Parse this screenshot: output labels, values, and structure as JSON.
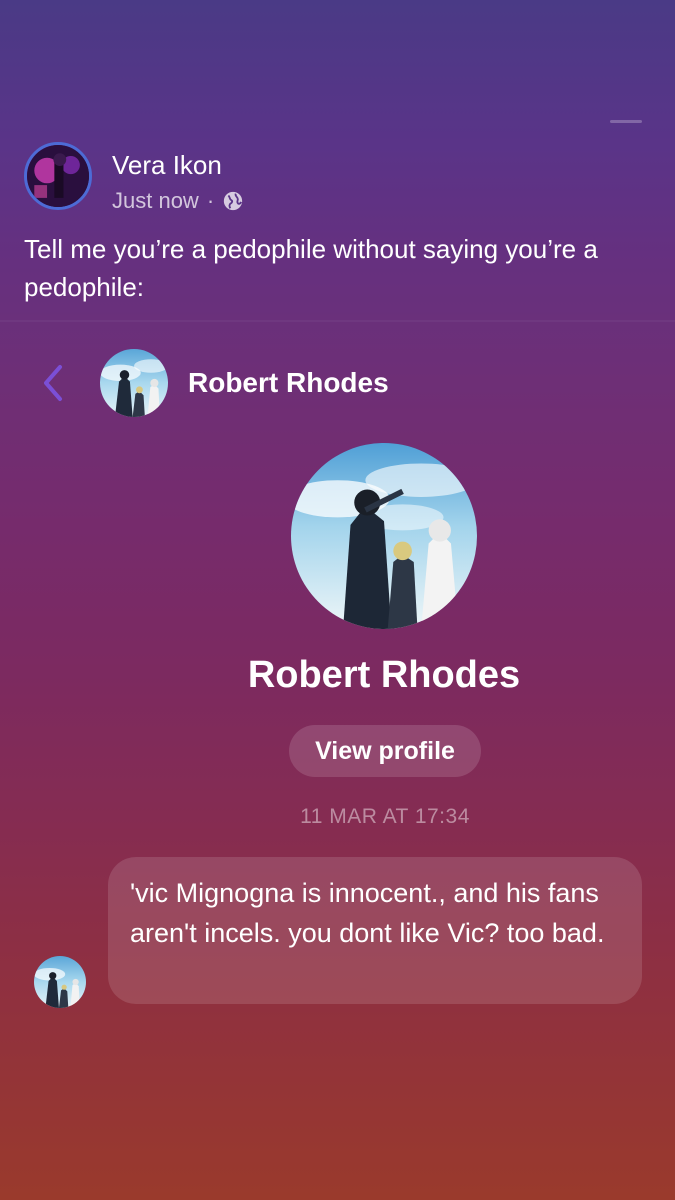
{
  "post": {
    "author": "Vera Ikon",
    "time": "Just now",
    "separator": "·",
    "privacy_icon": "globe-icon",
    "text": "Tell me you’re a pedophile without saying you’re a pedophile:"
  },
  "chat": {
    "header_name": "Robert Rhodes",
    "back_icon": "chevron-left-icon",
    "profile_name": "Robert Rhodes",
    "view_profile_label": "View profile",
    "timestamp": "11 MAR AT 17:34",
    "messages": [
      {
        "text": "'vic Mignogna is innocent., and his fans aren't incels. you dont like Vic? too bad."
      }
    ]
  },
  "colors": {
    "accent": "#7b4fd6",
    "avatar_ring": "#4d6bd6"
  }
}
